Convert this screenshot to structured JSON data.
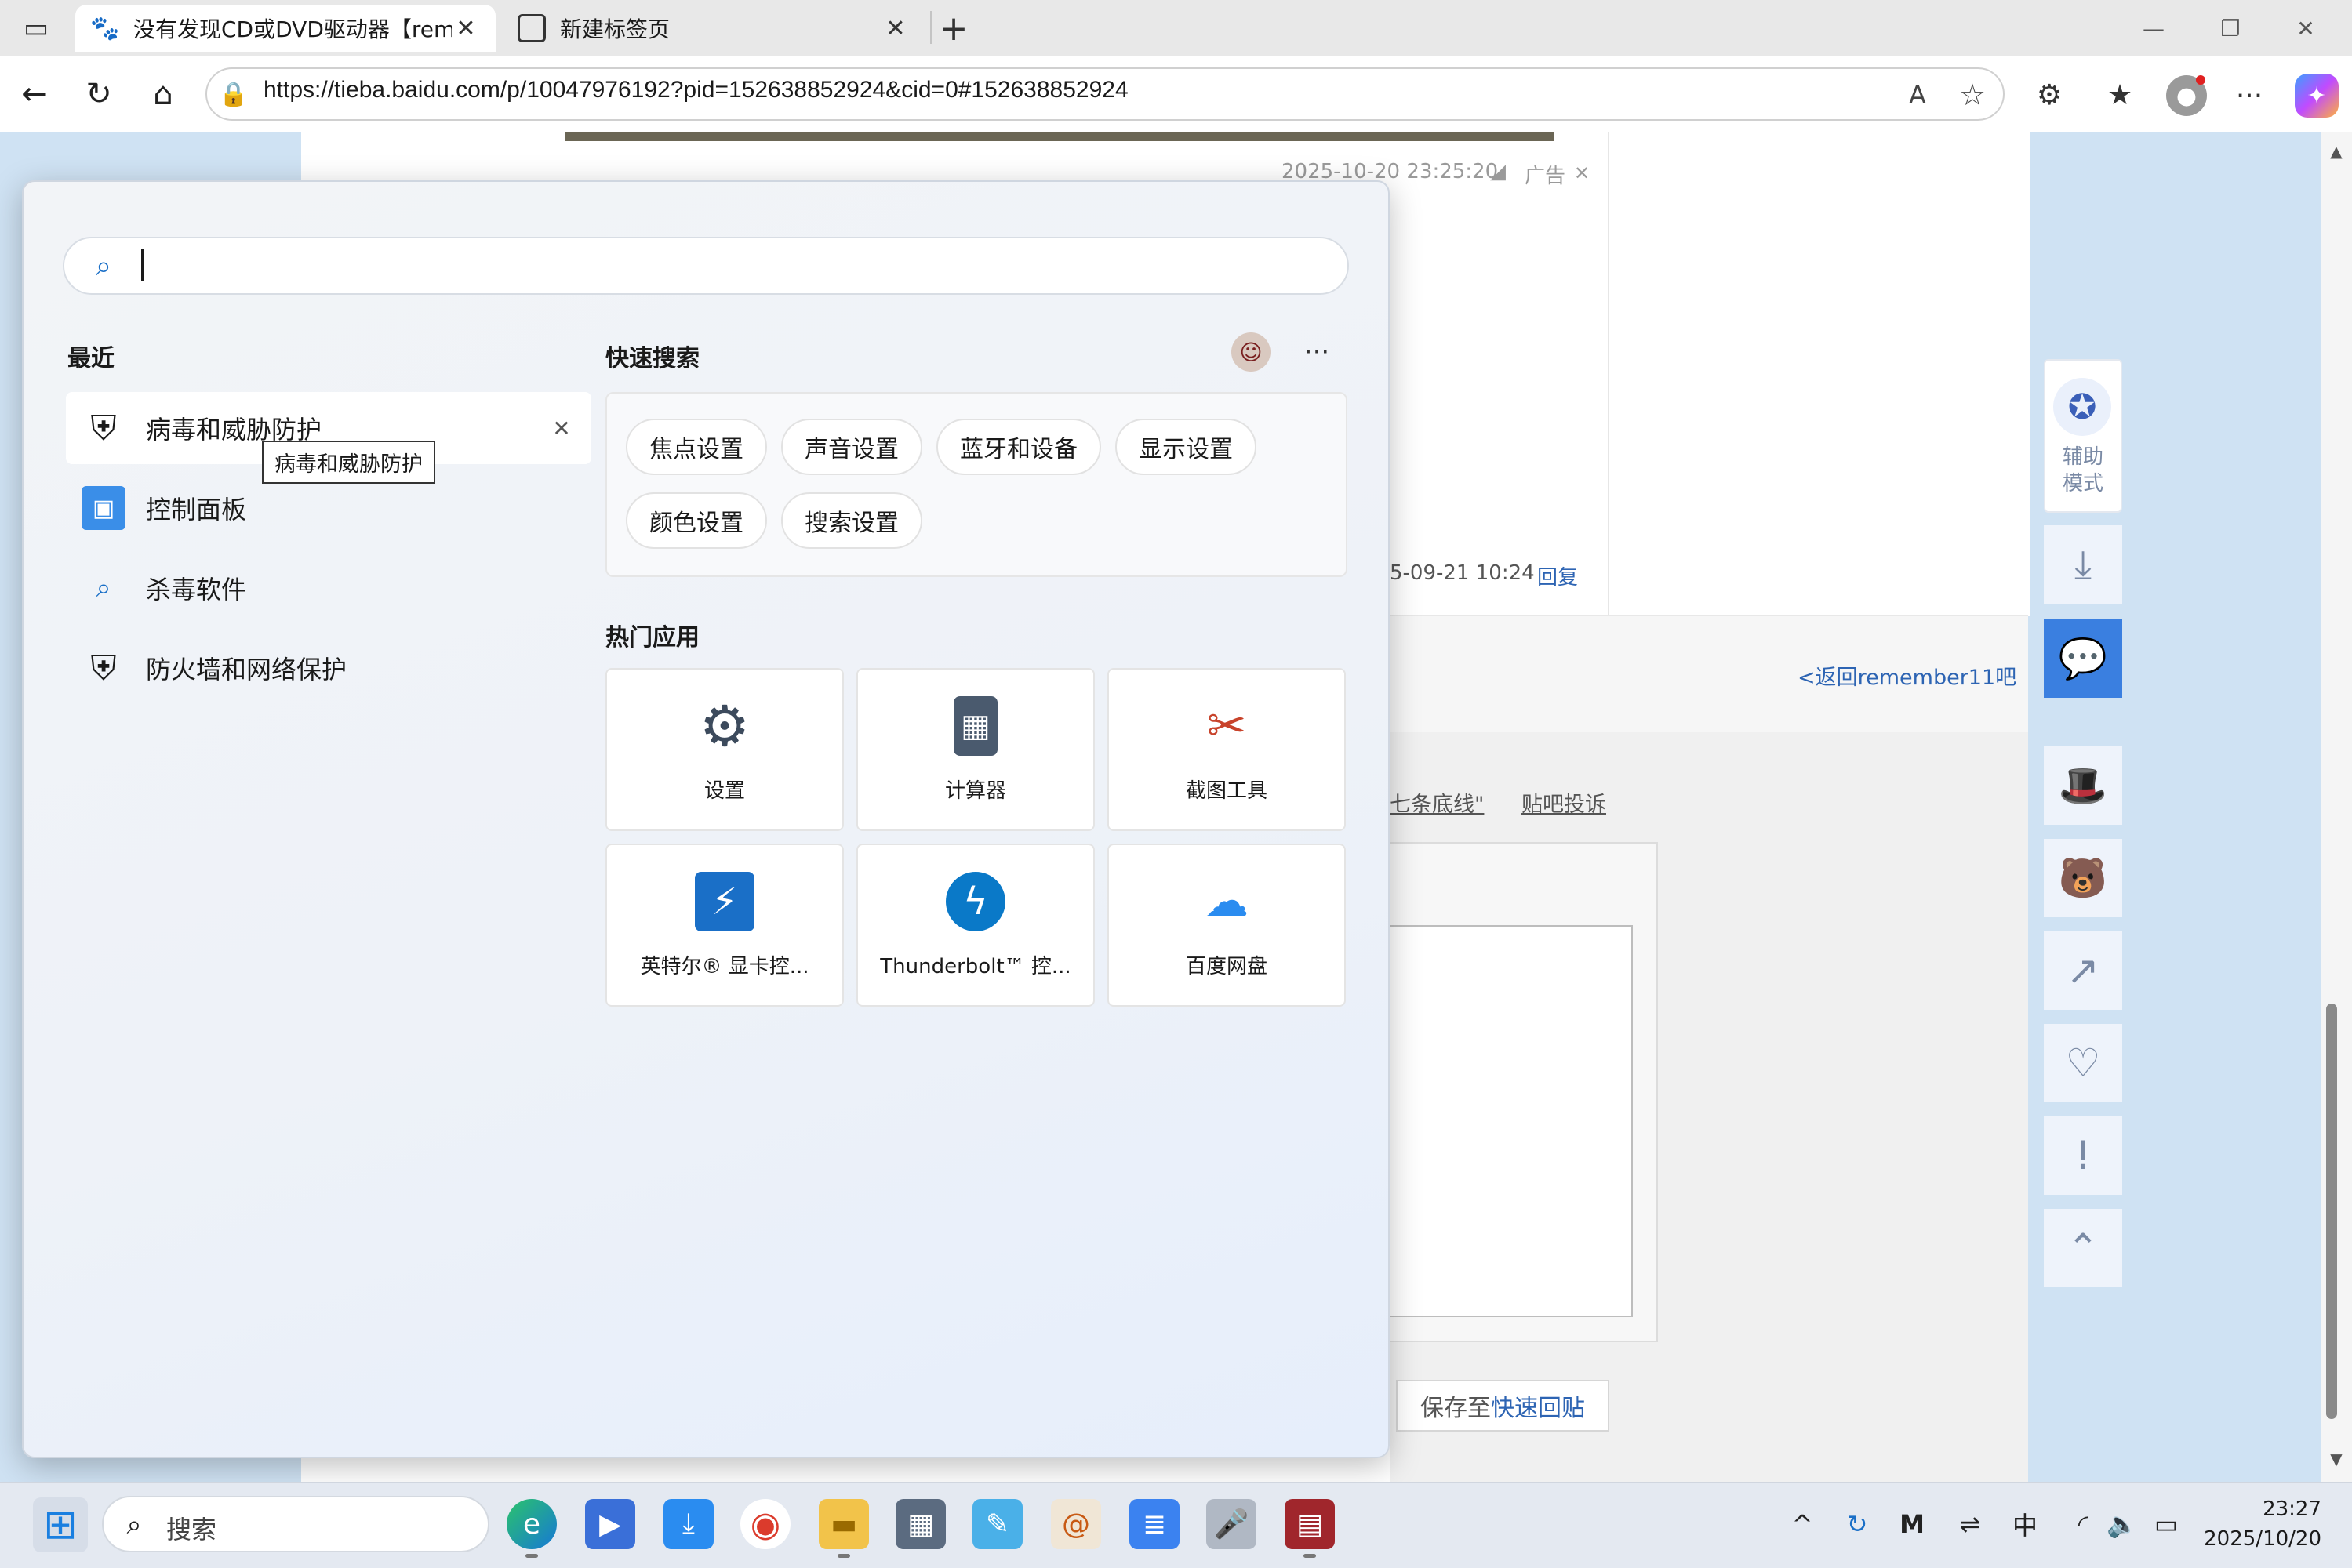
{
  "browser": {
    "tabs": [
      {
        "title": "没有发现CD或DVD驱动器【remem",
        "icon": "baidu-paw-icon"
      },
      {
        "title": "新建标签页",
        "icon": "newtab-icon"
      }
    ],
    "new_tab_symbol": "+",
    "url": "https://tieba.baidu.com/p/10047976192?pid=152638852924&cid=0#152638852924",
    "window_controls": {
      "minimize": "—",
      "restore": "❐",
      "close": "✕"
    }
  },
  "page": {
    "post_timestamp": "2025-10-20 23:25:20",
    "ad_label": "广告",
    "reply_timestamp": "5-09-21 10:24",
    "reply_link": "回复",
    "back_link": "<返回remember11吧",
    "rule_link": "七条底线\"",
    "complaint_link": "贴吧投诉",
    "save_button_prefix": "保存至",
    "save_button_link": "快速回贴",
    "assist_mode_label": "辅助\n模式"
  },
  "flyout": {
    "search_placeholder": "",
    "recent_title": "最近",
    "recent_items": [
      {
        "label": "病毒和威胁防护",
        "icon": "shield-icon"
      },
      {
        "label": "控制面板",
        "icon": "control-panel-icon"
      },
      {
        "label": "杀毒软件",
        "icon": "search-icon"
      },
      {
        "label": "防火墙和网络保护",
        "icon": "shield-icon"
      }
    ],
    "tooltip": "病毒和威胁防护",
    "quick_search_title": "快速搜索",
    "quick_chips_row1": [
      "焦点设置",
      "声音设置",
      "蓝牙和设备",
      "显示设置"
    ],
    "quick_chips_row2": [
      "颜色设置",
      "搜索设置"
    ],
    "more_symbol": "···",
    "hot_apps_title": "热门应用",
    "hot_apps": [
      {
        "label": "设置",
        "icon": "settings-gear-icon",
        "color": "#3c4a5c"
      },
      {
        "label": "计算器",
        "icon": "calculator-icon",
        "color": "#4a5a6e"
      },
      {
        "label": "截图工具",
        "icon": "snipping-tool-icon",
        "color": "#c8432b"
      },
      {
        "label": "英特尔® 显卡控...",
        "icon": "intel-graphics-icon",
        "color": "#1a6fc7"
      },
      {
        "label": "Thunderbolt™ 控...",
        "icon": "thunderbolt-icon",
        "color": "#0a79c8"
      },
      {
        "label": "百度网盘",
        "icon": "baidu-netdisk-icon",
        "color": "#2a8cf0"
      }
    ]
  },
  "taskbar": {
    "search_placeholder": "搜索",
    "ime": "中",
    "time": "23:27",
    "date": "2025/10/20"
  }
}
